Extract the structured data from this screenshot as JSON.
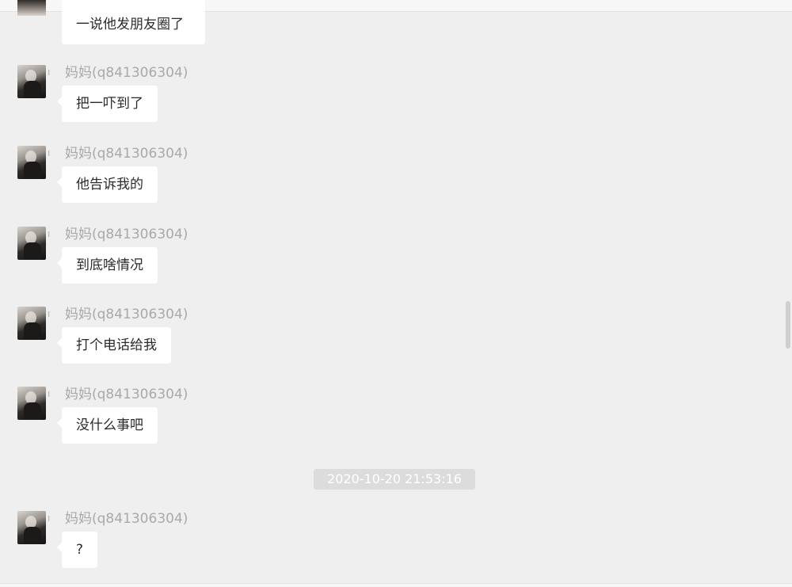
{
  "chat": {
    "top_message": {
      "text": "一说他发朋友圈了"
    },
    "messages": [
      {
        "sender": "妈妈(q841306304)",
        "text": "把一吓到了"
      },
      {
        "sender": "妈妈(q841306304)",
        "text": "他告诉我的"
      },
      {
        "sender": "妈妈(q841306304)",
        "text": "到底啥情况"
      },
      {
        "sender": "妈妈(q841306304)",
        "text": "打个电话给我"
      },
      {
        "sender": "妈妈(q841306304)",
        "text": "没什么事吧"
      }
    ],
    "timestamp": "2020-10-20 21:53:16",
    "last_message": {
      "sender": "妈妈(q841306304)",
      "text": "?"
    }
  },
  "ui": {
    "icons": {
      "avatar": "avatar-image",
      "mark": "status-mark"
    }
  }
}
